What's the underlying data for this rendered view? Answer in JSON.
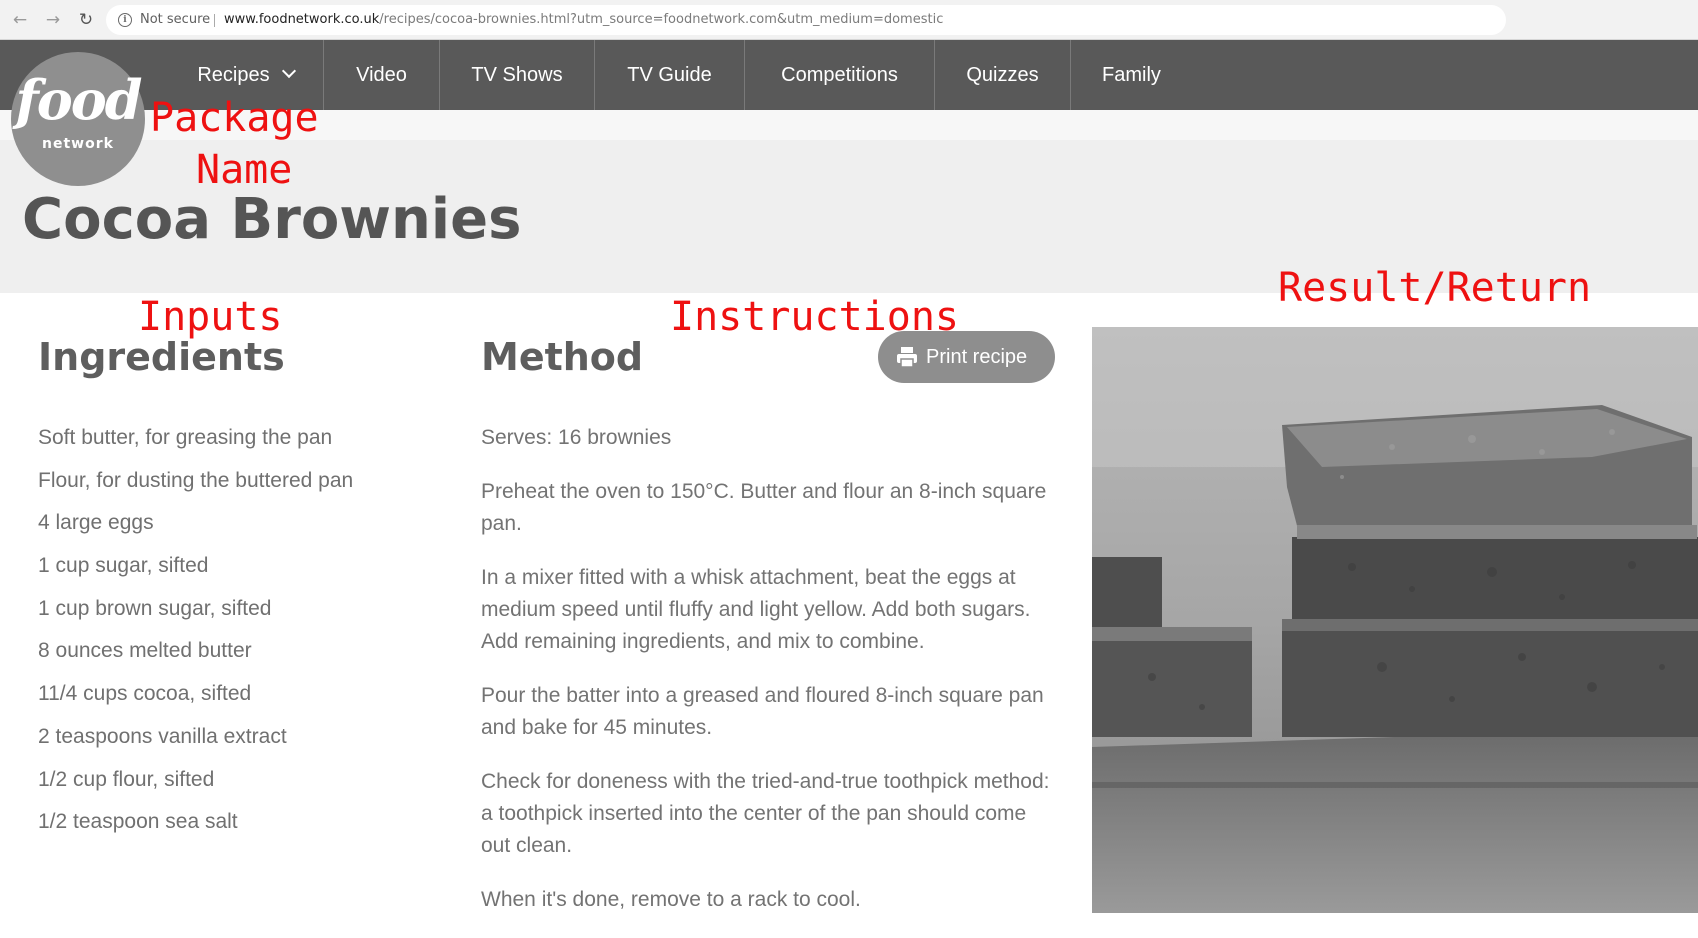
{
  "browser": {
    "security_label": "Not secure",
    "url_domain": "www.foodnetwork.co.uk",
    "url_path": "/recipes/cocoa-brownies.html?utm_source=foodnetwork.com&utm_medium=domestic",
    "info_glyph": "i",
    "back_glyph": "←",
    "forward_glyph": "→",
    "reload_glyph": "↻"
  },
  "logo": {
    "word1": "food",
    "word2": "network"
  },
  "nav": {
    "items": [
      "Recipes",
      "Video",
      "TV Shows",
      "TV Guide",
      "Competitions",
      "Quizzes",
      "Family"
    ]
  },
  "recipe": {
    "title": "Cocoa Brownies",
    "ingredients_heading": "Ingredients",
    "method_heading": "Method",
    "print_label": "Print recipe",
    "ingredients": [
      "Soft butter, for greasing the pan",
      "Flour, for dusting the buttered pan",
      "4 large eggs",
      "1 cup sugar, sifted",
      "1 cup brown sugar, sifted",
      "8 ounces melted butter",
      "11/4 cups cocoa, sifted",
      "2 teaspoons vanilla extract",
      "1/2 cup flour, sifted",
      "1/2 teaspoon sea salt"
    ],
    "serves": "Serves: 16 brownies",
    "steps": [
      "Preheat the oven to 150°C. Butter and flour an 8-inch square pan.",
      "In a mixer fitted with a whisk attachment, beat the eggs at medium speed until fluffy and light yellow. Add both sugars. Add remaining ingredients, and mix to combine.",
      "Pour the batter into a greased and floured 8-inch square pan and bake for 45 minutes.",
      "Check for doneness with the tried-and-true toothpick method: a toothpick inserted into the center of the pan should come out clean.",
      "When it's done, remove to a rack to cool."
    ]
  },
  "annotations": {
    "package": "Package",
    "name": "Name",
    "inputs": "Inputs",
    "instructions": "Instructions",
    "result": "Result/Return"
  },
  "colors": {
    "nav_bg": "#595959",
    "hero_bg": "#efefef",
    "annotation": "#ee1111",
    "button_bg": "#8e8e8e"
  }
}
